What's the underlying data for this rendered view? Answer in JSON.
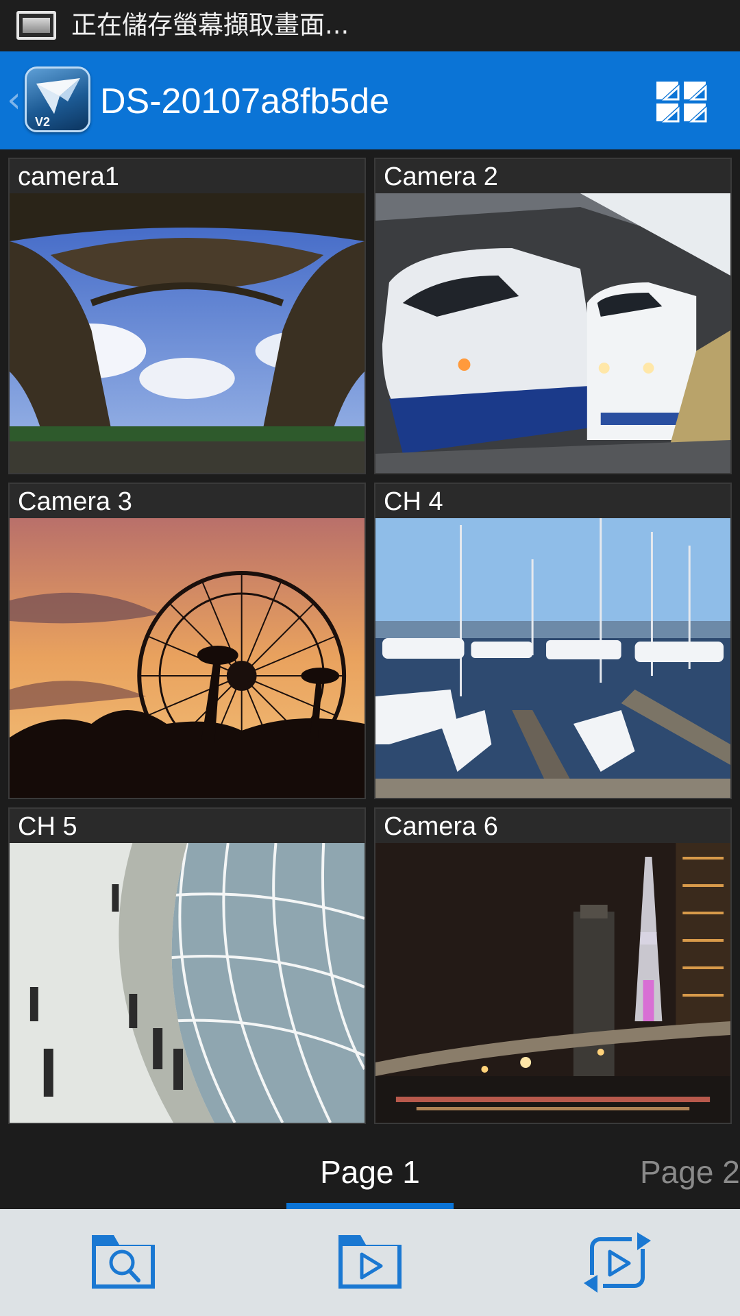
{
  "status_bar": {
    "notification_text": "正在儲存螢幕擷取畫面...",
    "icon": "screenshot-icon"
  },
  "app_bar": {
    "title": "DS-20107a8fb5de",
    "back_icon": "chevron-left-icon",
    "logo_badge": "V2",
    "layout_icon": "grid-layout-icon",
    "color": "#0b74d6"
  },
  "cameras": [
    {
      "label": "camera1",
      "scene": "eiffel-tower"
    },
    {
      "label": "Camera 2",
      "scene": "bullet-trains"
    },
    {
      "label": "Camera 3",
      "scene": "ferris-wheel-sunset"
    },
    {
      "label": "CH 4",
      "scene": "marina-boats"
    },
    {
      "label": "CH 5",
      "scene": "glass-dome-atrium"
    },
    {
      "label": "Camera 6",
      "scene": "night-tower-bridge"
    }
  ],
  "pager": {
    "pages": [
      "Page 1",
      "Page 2"
    ],
    "active": "Page 1",
    "indicator_color": "#0b74d6"
  },
  "toolbar": {
    "buttons": [
      "folder-search-icon",
      "folder-play-icon",
      "playback-sync-icon"
    ],
    "icon_color": "#1a78d2"
  }
}
